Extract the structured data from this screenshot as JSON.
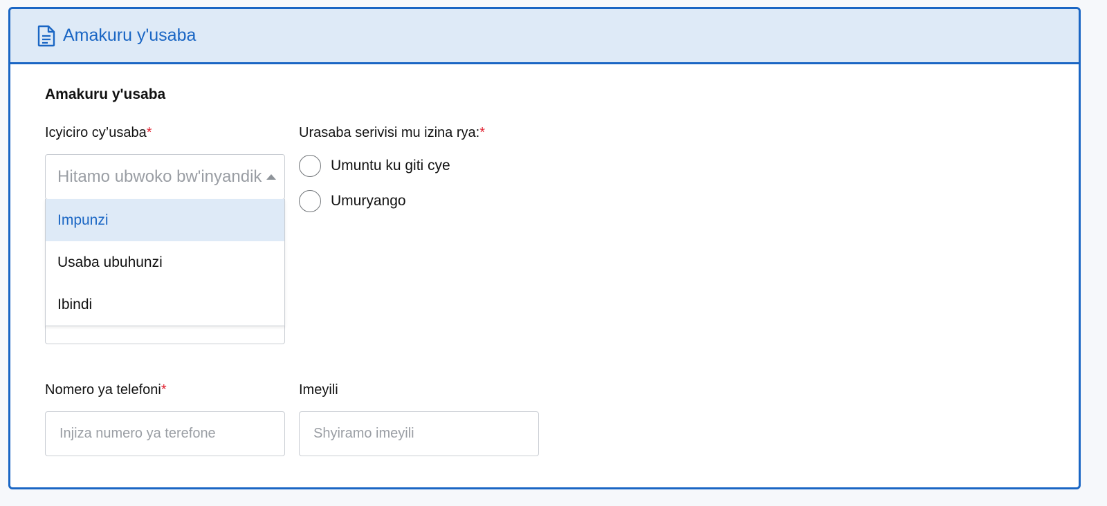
{
  "header": {
    "title": "Amakuru y'usaba",
    "icon": "document-icon"
  },
  "section": {
    "title": "Amakuru y'usaba"
  },
  "applicant_category": {
    "label": "Icyiciro cy’usaba",
    "required_mark": "*",
    "placeholder": "Hitamo ubwoko bw'inyandiko",
    "options": [
      {
        "label": "Impunzi",
        "highlighted": true
      },
      {
        "label": "Usaba ubuhunzi",
        "highlighted": false
      },
      {
        "label": "Ibindi",
        "highlighted": false
      }
    ]
  },
  "service_on_behalf": {
    "label": "Urasaba serivisi mu izina rya:",
    "required_mark": "*",
    "options": [
      {
        "label": "Umuntu ku giti cye",
        "selected": false
      },
      {
        "label": "Umuryango",
        "selected": false
      }
    ]
  },
  "phone": {
    "label": "Nomero ya telefoni",
    "required_mark": "*",
    "placeholder": "Injiza numero ya terefone",
    "value": ""
  },
  "email": {
    "label": "Imeyili",
    "placeholder": "Shyiramo imeyili",
    "value": ""
  },
  "colors": {
    "accent": "#1a66c4",
    "header_bg": "#deeaf7",
    "required": "#e0202f",
    "placeholder": "#9a9ea4"
  }
}
